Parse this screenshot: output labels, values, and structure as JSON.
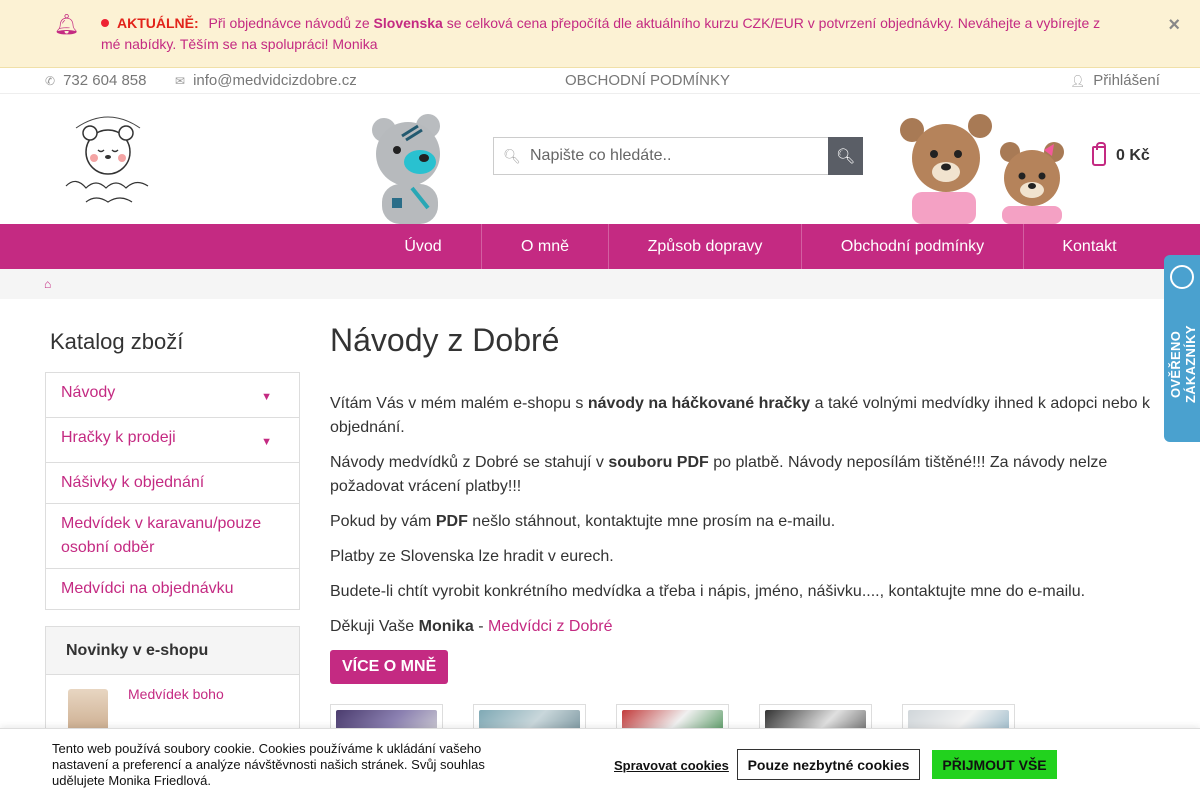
{
  "notice": {
    "tag": "AKTUÁLNĚ:",
    "text_before": "Při objednávce návodů ze",
    "country": "Slovenska",
    "text_after": "se celková cena přepočítá dle aktuálního kurzu CZK/EUR v potvrzení objednávky. Neváhejte a vybírejte z mé nabídky. Těším se na spolupráci! Monika",
    "close": "×"
  },
  "topbar": {
    "phone": "732 604 858",
    "email": "info@medvidcizdobre.cz",
    "terms": "OBCHODNÍ PODMÍNKY",
    "login": "Přihlášení"
  },
  "header": {
    "search_placeholder": "Napište co hledáte..",
    "cart_amount": "0 Kč"
  },
  "nav": {
    "items": [
      "Úvod",
      "O mně",
      "Způsob dopravy",
      "Obchodní podmínky",
      "Kontakt"
    ]
  },
  "sidebar": {
    "title": "Katalog zboží",
    "items": [
      "Návody",
      "Hračky k prodeji",
      "Nášivky k objednání",
      "Medvídek v karavanu/pouze osobní odběr",
      "Medvídci na objednávku"
    ],
    "news_title": "Novinky v e-shopu",
    "news_item": "Medvídek boho"
  },
  "main": {
    "title": "Návody z Dobré",
    "p1_a": "Vítám Vás v mém malém e-shopu s",
    "p1_b": "návody na háčkované hračky",
    "p1_c": "a také volnými medvídky ihned k adopci nebo k objednání.",
    "p2_a": "Návody medvídků z Dobré se stahují v",
    "p2_b": "souboru PDF",
    "p2_c": "po platbě. Návody neposílám tištěné!!! Za návody nelze požadovat vrácení platby!!!",
    "p3_a": "Pokud by vám",
    "p3_b": "PDF",
    "p3_c": "nešlo stáhnout, kontaktujte mne prosím na e-mailu.",
    "p4": "Platby ze Slovenska lze hradit v eurech.",
    "p5": "Budete-li chtít vyrobit konkrétního medvídka a třeba i nápis, jméno, nášivku...., kontaktujte mne do e-mailu.",
    "p6_a": "Děkuji Vaše",
    "p6_b": "Monika",
    "p6_sep": "-",
    "p6_link": "Medvídci z Dobré",
    "more_button": "VÍCE O MNĚ"
  },
  "badge": {
    "text": "OVĚŘENO ZÁKAZNÍKY"
  },
  "cookie": {
    "message": "Tento web používá soubory cookie. Cookies používáme k ukládání vašeho nastavení a preferencí a analýze návštěvnosti našich stránek. Svůj souhlas udělujete Monika Friedlová.",
    "manage": "Spravovat cookies",
    "necessary": "Pouze nezbytné cookies",
    "accept": "PŘIJMOUT VŠE"
  },
  "colors": {
    "brand": "#c42a82",
    "accept": "#22d21e",
    "badge": "#4aa1cf"
  },
  "icons": [
    "bell-icon",
    "phone-icon",
    "envelope-icon",
    "user-icon",
    "search-icon",
    "cart-icon",
    "home-icon",
    "chevron-down-icon"
  ]
}
